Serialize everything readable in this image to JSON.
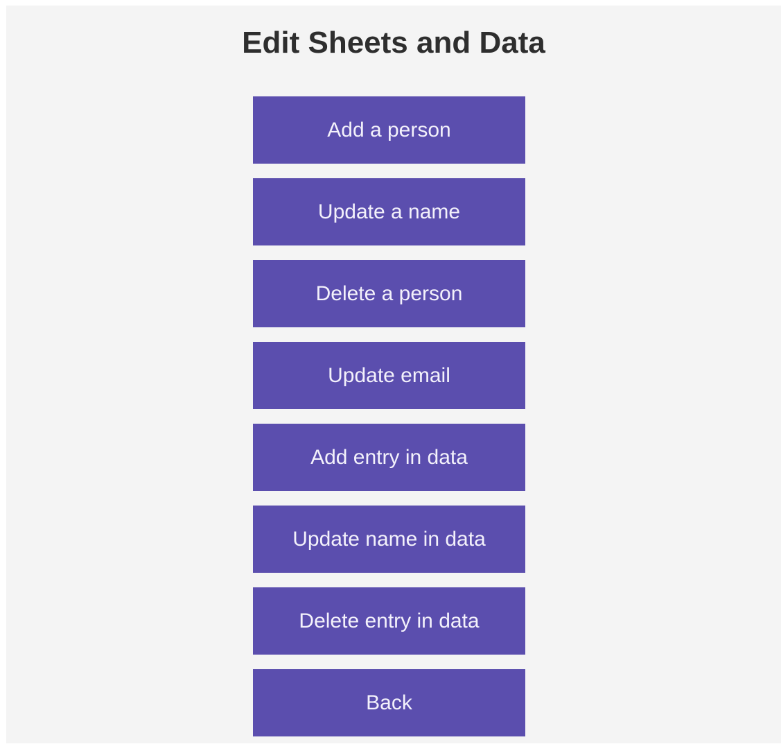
{
  "header": {
    "title": "Edit Sheets and Data"
  },
  "menu": {
    "buttons": [
      {
        "label": "Add a person"
      },
      {
        "label": "Update a name"
      },
      {
        "label": "Delete a person"
      },
      {
        "label": "Update email"
      },
      {
        "label": "Add entry in data"
      },
      {
        "label": "Update name in data"
      },
      {
        "label": "Delete entry in data"
      },
      {
        "label": "Back"
      }
    ]
  },
  "colors": {
    "page_background": "#f4f4f4",
    "button_background": "#5b4eae",
    "button_text": "#f3f1fb",
    "title_text": "#2e2e2e"
  }
}
